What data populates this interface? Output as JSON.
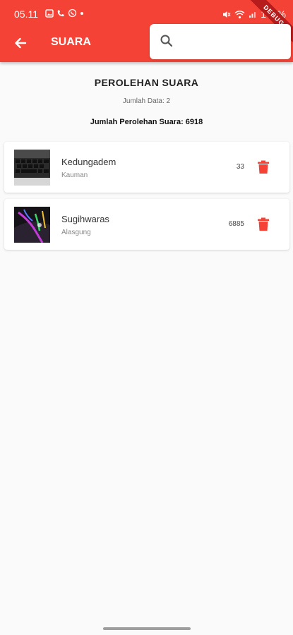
{
  "status_bar": {
    "time": "05.11",
    "battery": "100%"
  },
  "appbar": {
    "title": "SUARA",
    "search_placeholder": "",
    "search_value": ""
  },
  "debug_banner": "DEBUG",
  "summary": {
    "heading": "PEROLEHAN SUARA",
    "count_text": "Jumlah Data: 2",
    "total_text": "Jumlah Perolehan Suara: 6918"
  },
  "items": [
    {
      "name": "Kedungadem",
      "subtitle": "Kauman",
      "votes": "33",
      "thumb": "keyboard-photo"
    },
    {
      "name": "Sugihwaras",
      "subtitle": "Alasgung",
      "votes": "6885",
      "thumb": "rgb-keyboard-photo"
    }
  ],
  "colors": {
    "primary": "#f44336",
    "delete": "#f44336",
    "background": "#fafafa"
  }
}
